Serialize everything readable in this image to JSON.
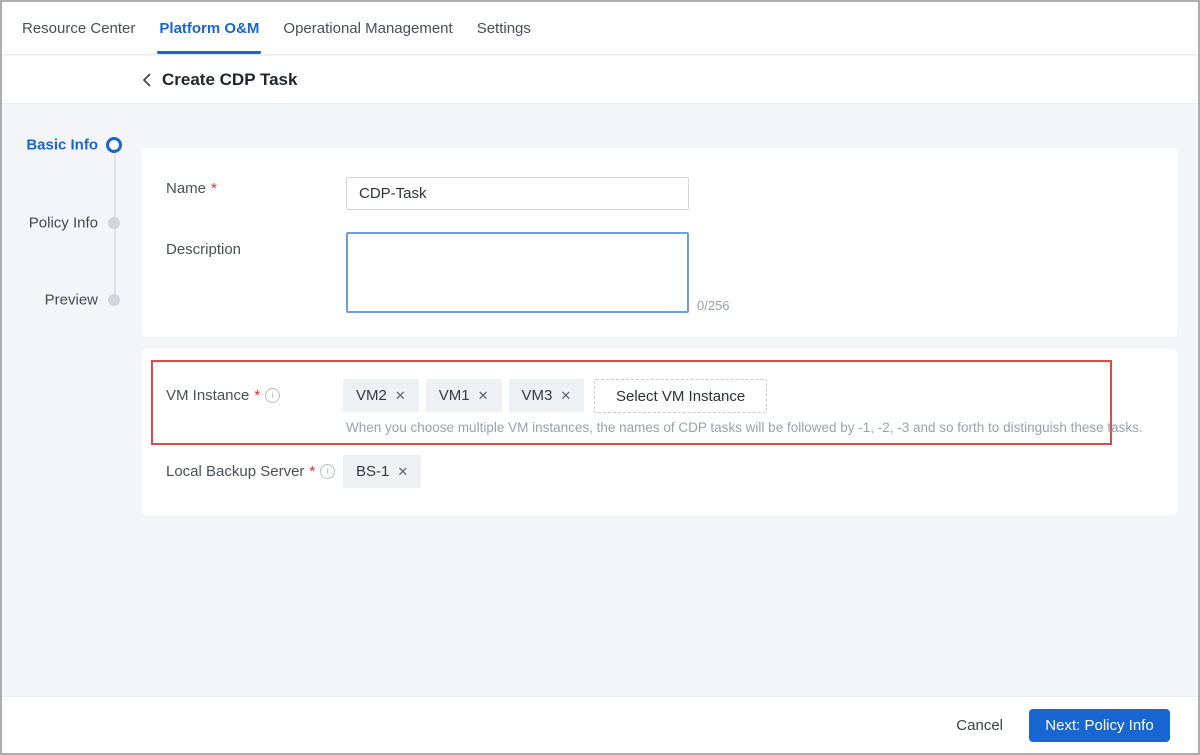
{
  "nav": {
    "tabs": [
      {
        "label": "Resource Center",
        "active": false
      },
      {
        "label": "Platform O&M",
        "active": true
      },
      {
        "label": "Operational Management",
        "active": false
      },
      {
        "label": "Settings",
        "active": false
      }
    ]
  },
  "header": {
    "title": "Create CDP Task"
  },
  "stepper": {
    "steps": [
      {
        "label": "Basic Info",
        "state": "active"
      },
      {
        "label": "Policy Info",
        "state": "pending"
      },
      {
        "label": "Preview",
        "state": "pending"
      }
    ]
  },
  "form": {
    "name": {
      "label": "Name",
      "required_mark": "*",
      "value": "CDP-Task"
    },
    "description": {
      "label": "Description",
      "value": "",
      "counter": "0/256"
    },
    "vm_instance": {
      "label": "VM Instance",
      "required_mark": "*",
      "info_icon": "i",
      "tags": [
        "VM2",
        "VM1",
        "VM3"
      ],
      "remove_icon": "✕",
      "select_button_label": "Select VM Instance",
      "hint": "When you choose multiple VM instances, the names of CDP tasks will be followed by -1, -2, -3 and so forth to distinguish these tasks."
    },
    "local_backup_server": {
      "label": "Local Backup Server",
      "required_mark": "*",
      "info_icon": "i",
      "tags": [
        "BS-1"
      ],
      "remove_icon": "✕"
    }
  },
  "footer": {
    "cancel_label": "Cancel",
    "next_label": "Next: Policy Info"
  },
  "colors": {
    "accent_blue": "#1766d1",
    "focus_border_blue": "#6d9ce0",
    "highlight_red": "#e24a49",
    "tag_background": "#eef0f4",
    "page_background": "#f4f5f9"
  }
}
